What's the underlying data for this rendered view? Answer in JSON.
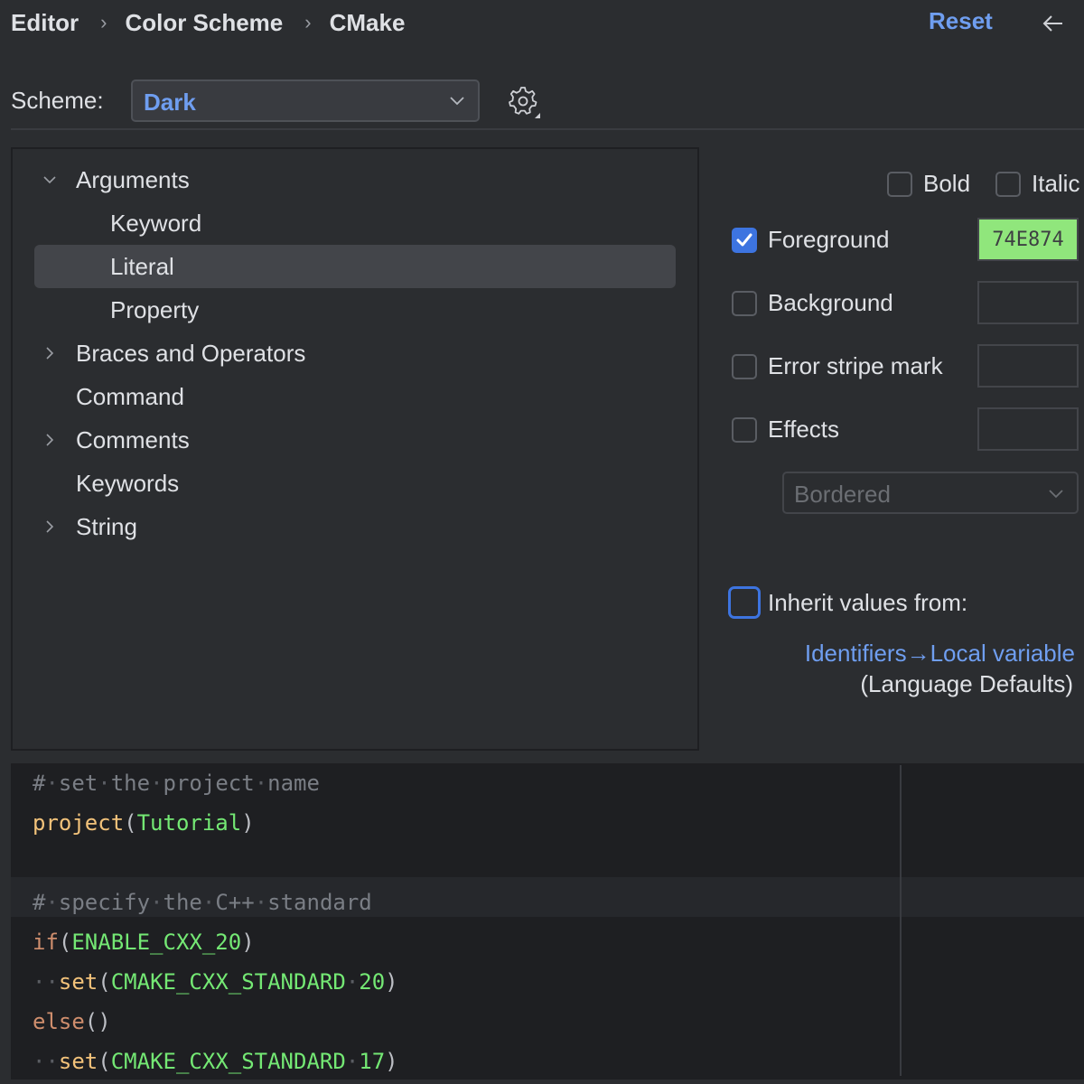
{
  "breadcrumb": [
    "Editor",
    "Color Scheme",
    "CMake"
  ],
  "header": {
    "reset_label": "Reset",
    "back_icon": "arrow-left-icon"
  },
  "scheme": {
    "label": "Scheme:",
    "value": "Dark",
    "settings_icon": "gear-icon"
  },
  "tree": {
    "items": [
      {
        "label": "Arguments",
        "level": 0,
        "expandable": true,
        "expanded": true
      },
      {
        "label": "Keyword",
        "level": 1,
        "expandable": false
      },
      {
        "label": "Literal",
        "level": 1,
        "expandable": false,
        "selected": true
      },
      {
        "label": "Property",
        "level": 1,
        "expandable": false
      },
      {
        "label": "Braces and Operators",
        "level": 0,
        "expandable": true,
        "expanded": false
      },
      {
        "label": "Command",
        "level": 0,
        "expandable": false
      },
      {
        "label": "Comments",
        "level": 0,
        "expandable": true,
        "expanded": false
      },
      {
        "label": "Keywords",
        "level": 0,
        "expandable": false
      },
      {
        "label": "String",
        "level": 0,
        "expandable": true,
        "expanded": false
      }
    ]
  },
  "options": {
    "bold": {
      "label": "Bold",
      "checked": false
    },
    "italic": {
      "label": "Italic",
      "checked": false
    },
    "foreground": {
      "label": "Foreground",
      "checked": true,
      "color": "74E874",
      "color_hex": "#90e67c"
    },
    "background": {
      "label": "Background",
      "checked": false
    },
    "error_stripe": {
      "label": "Error stripe mark",
      "checked": false
    },
    "effects": {
      "label": "Effects",
      "checked": false,
      "type": "Bordered"
    },
    "inherit": {
      "label": "Inherit values from:",
      "checked": false,
      "link": "Identifiers→Local variable",
      "source": "(Language Defaults)"
    }
  },
  "preview": {
    "lines": [
      [
        {
          "t": "#",
          "c": "comment"
        },
        {
          "t": "·",
          "c": "ws"
        },
        {
          "t": "set",
          "c": "comment"
        },
        {
          "t": "·",
          "c": "ws"
        },
        {
          "t": "the",
          "c": "comment"
        },
        {
          "t": "·",
          "c": "ws"
        },
        {
          "t": "project",
          "c": "comment"
        },
        {
          "t": "·",
          "c": "ws"
        },
        {
          "t": "name",
          "c": "comment"
        }
      ],
      [
        {
          "t": "project",
          "c": "cmd"
        },
        {
          "t": "(",
          "c": "paren"
        },
        {
          "t": "Tutorial",
          "c": "arg"
        },
        {
          "t": ")",
          "c": "paren"
        }
      ],
      [],
      [
        {
          "t": "#",
          "c": "comment"
        },
        {
          "t": "·",
          "c": "ws"
        },
        {
          "t": "specify",
          "c": "comment"
        },
        {
          "t": "·",
          "c": "ws"
        },
        {
          "t": "the",
          "c": "comment"
        },
        {
          "t": "·",
          "c": "ws"
        },
        {
          "t": "C++",
          "c": "comment"
        },
        {
          "t": "·",
          "c": "ws"
        },
        {
          "t": "standard",
          "c": "comment"
        }
      ],
      [
        {
          "t": "if",
          "c": "kw"
        },
        {
          "t": "(",
          "c": "paren"
        },
        {
          "t": "ENABLE_CXX_20",
          "c": "arg"
        },
        {
          "t": ")",
          "c": "paren"
        }
      ],
      [
        {
          "t": "··",
          "c": "ws"
        },
        {
          "t": "set",
          "c": "cmd"
        },
        {
          "t": "(",
          "c": "paren"
        },
        {
          "t": "CMAKE_CXX_STANDARD",
          "c": "arg"
        },
        {
          "t": "·",
          "c": "ws"
        },
        {
          "t": "20",
          "c": "arg"
        },
        {
          "t": ")",
          "c": "paren"
        }
      ],
      [
        {
          "t": "else",
          "c": "kw"
        },
        {
          "t": "()",
          "c": "paren"
        }
      ],
      [
        {
          "t": "··",
          "c": "ws"
        },
        {
          "t": "set",
          "c": "cmd"
        },
        {
          "t": "(",
          "c": "paren"
        },
        {
          "t": "CMAKE_CXX_STANDARD",
          "c": "arg"
        },
        {
          "t": "·",
          "c": "ws"
        },
        {
          "t": "17",
          "c": "arg"
        },
        {
          "t": ")",
          "c": "paren"
        }
      ]
    ]
  },
  "colors": {
    "accent": "#3d74e0",
    "link": "#6f9ef0",
    "background": "#2b2d30",
    "editor_bg": "#1e1f22",
    "selection": "#43454a"
  }
}
